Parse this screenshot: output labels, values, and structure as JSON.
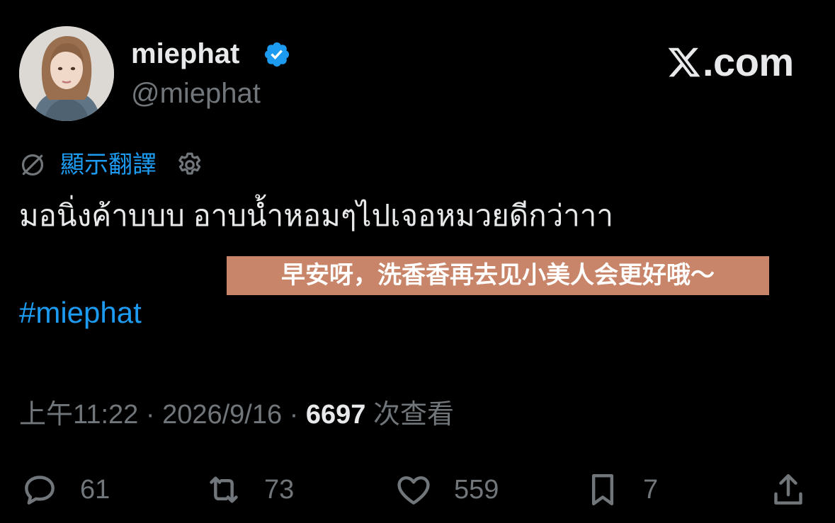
{
  "author": {
    "display_name": "miephat",
    "handle": "@miephat",
    "verified": true,
    "avatar_icon": "avatar-photo"
  },
  "brand": {
    "logo_icon": "x-logo-icon",
    "text": ".com"
  },
  "translate": {
    "icon": "globe-off-icon",
    "label": "顯示翻譯",
    "settings_icon": "gear-icon"
  },
  "tweet": {
    "text": "มอนิ่งค้าบบบ อาบน้ำหอมๆไปเจอหมวยดีกว่าาา",
    "caption_overlay": "早安呀，洗香香再去见小美人会更好哦～",
    "hashtag": "#miephat"
  },
  "meta": {
    "time": "上午11:22",
    "separator": " · ",
    "date": "2026/9/16",
    "views": "6697",
    "views_label": "次查看"
  },
  "actions": {
    "replies": "61",
    "reposts": "73",
    "likes": "559",
    "bookmarks": "7"
  },
  "colors": {
    "background": "#000000",
    "text_primary": "#e7e9ea",
    "text_secondary": "#71767b",
    "accent": "#1d9bf0",
    "caption_bg": "#c8856a"
  }
}
